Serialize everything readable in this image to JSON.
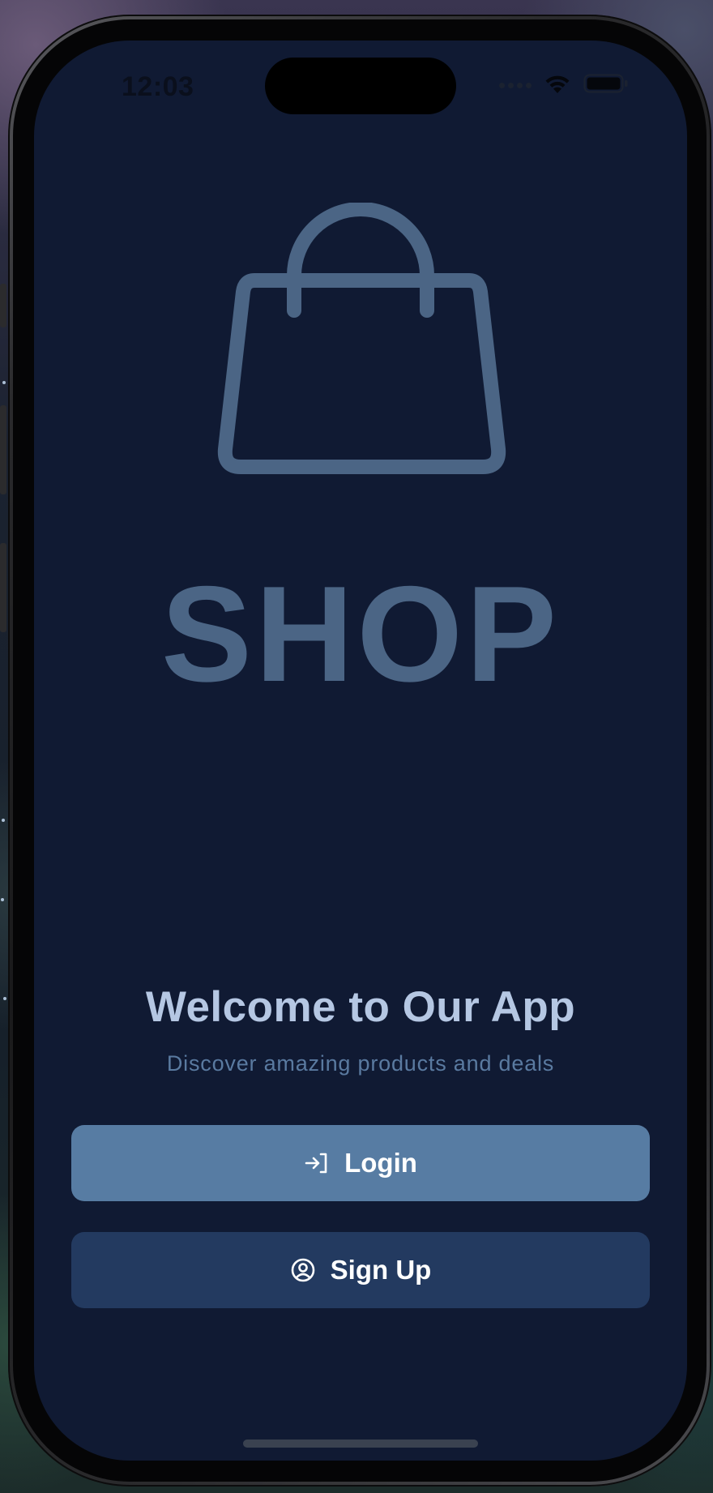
{
  "status_bar": {
    "time": "12:03",
    "wifi_icon": "wifi-icon",
    "battery_icon": "battery-icon",
    "signal_icon": "signal-dots-icon"
  },
  "logo": {
    "icon": "shopping-bag-icon",
    "text": "SHOP",
    "color": "#4b6585"
  },
  "welcome": {
    "title": "Welcome to Our App",
    "subtitle": "Discover amazing products and deals"
  },
  "buttons": {
    "login": {
      "label": "Login",
      "icon": "login-arrow-icon",
      "color": "#577ca3"
    },
    "signup": {
      "label": "Sign Up",
      "icon": "user-circle-icon",
      "color": "#233a60"
    }
  },
  "colors": {
    "screen_background": "#101a33",
    "title_text": "#b5c7e3",
    "subtitle_text": "#5a7aa0"
  }
}
